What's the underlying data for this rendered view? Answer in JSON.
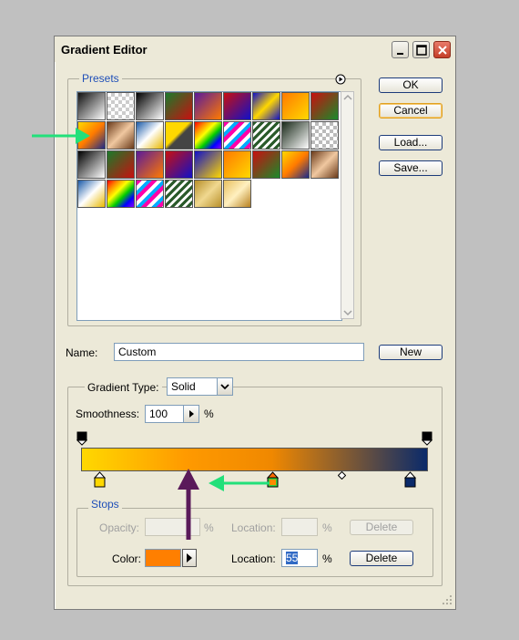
{
  "window": {
    "title": "Gradient Editor"
  },
  "presets": {
    "label": "Presets",
    "swatches": [
      "linear-gradient(135deg,#111,#fff)",
      "repeating-conic-gradient(#ccc 0 25%,#fff 0 50%) 0 0/8px 8px",
      "linear-gradient(135deg,#000,#fff)",
      "linear-gradient(135deg,#1a7a2a,#c81010)",
      "linear-gradient(135deg,#5a1a9a,#ff7a00)",
      "linear-gradient(135deg,#c81010,#1010c8)",
      "linear-gradient(135deg,#1010c8,#ffd800,#1010c8)",
      "linear-gradient(135deg,#ff7a00,#ffd800)",
      "linear-gradient(135deg,#c81010,#1a8a2a)",
      "linear-gradient(135deg,#ffd800,#ff7a00,#1a2a8a)",
      "linear-gradient(135deg,#6a3a1a,#f0c8a0,#6a3a1a)",
      "linear-gradient(135deg,#1a5aa8,#fff,#e8b800)",
      "linear-gradient(135deg,#ffd800 45%,#444 55%)",
      "linear-gradient(135deg,#ff0000,#ff8800,#ffff00,#00cc00,#0000ff,#8800ff)",
      "repeating-linear-gradient(135deg,#ff00aa 0 4px,#fff 4px 8px,#00aaff 8px 12px)",
      "repeating-linear-gradient(135deg,#2a5a2a 0 3px,#fff 3px 6px)",
      "linear-gradient(135deg,#1a2a1a,#fff)",
      "repeating-conic-gradient(#bbb 0 25%,#fff 0 50%) 0 0/8px 8px",
      "linear-gradient(135deg,#000,#fff)",
      "linear-gradient(135deg,#1a7a2a,#c81010)",
      "linear-gradient(135deg,#5a1a9a,#ff7a00)",
      "linear-gradient(135deg,#c81010,#1010c8)",
      "linear-gradient(135deg,#1010c8,#ffd800)",
      "linear-gradient(135deg,#ff7a00,#ffd800)",
      "linear-gradient(135deg,#c81010,#1a8a2a)",
      "linear-gradient(135deg,#ffd800,#ff7a00,#1a2a8a)",
      "linear-gradient(135deg,#6a3a1a,#f0c8a0,#6a3a1a)",
      "linear-gradient(135deg,#1a5aa8,#fff,#e8b800)",
      "linear-gradient(135deg,#ff0000,#ff8800,#ffff00,#00cc00,#0000ff,#8800ff)",
      "repeating-linear-gradient(135deg,#ff00aa 0 4px,#fff 4px 8px,#00aaff 8px 12px)",
      "repeating-linear-gradient(135deg,#2a5a2a 0 3px,#fff 3px 6px)",
      "linear-gradient(135deg,#b8902a,#f0d890,#b8902a)",
      "linear-gradient(135deg,#e8c060,#fff0c0,#b88020)"
    ]
  },
  "buttons": {
    "ok": "OK",
    "cancel": "Cancel",
    "load": "Load...",
    "save": "Save...",
    "new": "New"
  },
  "name_field": {
    "label": "Name:",
    "value": "Custom"
  },
  "gradient_type": {
    "label": "Gradient Type:",
    "value": "Solid"
  },
  "smoothness": {
    "label": "Smoothness:",
    "value": "100",
    "unit": "%"
  },
  "gradient": {
    "css": "linear-gradient(to right,#ffd800 0%,#ff9a00 30%,#f08800 55%,#0a2a6a 100%)",
    "color_stops": [
      {
        "position": 0,
        "color": "#ffd800"
      },
      {
        "position": 55,
        "color": "#ff8a00"
      },
      {
        "position": 100,
        "color": "#0a2a6a"
      }
    ]
  },
  "stops": {
    "label": "Stops",
    "opacity_label": "Opacity:",
    "opacity_unit": "%",
    "opacity_location_label": "Location:",
    "opacity_location_unit": "%",
    "opacity_delete": "Delete",
    "color_label": "Color:",
    "color_value": "#ff7f00",
    "color_location_label": "Location:",
    "color_location_value": "55",
    "color_location_unit": "%",
    "color_delete": "Delete"
  },
  "annotations": {
    "arrow_color_green": "#22e07a",
    "arrow_color_purple": "#5a1a5a"
  }
}
